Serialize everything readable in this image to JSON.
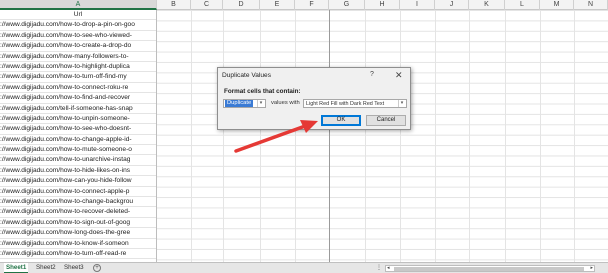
{
  "columns": [
    "A",
    "B",
    "C",
    "D",
    "E",
    "F",
    "G",
    "H",
    "I",
    "J",
    "K",
    "L",
    "M",
    "N"
  ],
  "header_cell": "Url",
  "urls": [
    "://www.digijadu.com/how-to-drop-a-pin-on-goo",
    "://www.digijadu.com/how-to-see-who-viewed-",
    "://www.digijadu.com/how-to-create-a-drop-do",
    "://www.digijadu.com/how-many-followers-to-",
    "://www.digijadu.com/how-to-highlight-duplica",
    "://www.digijadu.com/how-to-turn-off-find-my",
    "://www.digijadu.com/how-to-connect-roku-re",
    "://www.digijadu.com/how-to-find-and-recover",
    "://www.digijadu.com/tell-if-someone-has-snap",
    "://www.digijadu.com/how-to-unpin-someone-",
    "://www.digijadu.com/how-to-see-who-doesnt-",
    "://www.digijadu.com/how-to-change-apple-id-",
    "://www.digijadu.com/how-to-mute-someone-o",
    "://www.digijadu.com/how-to-unarchive-instag",
    "://www.digijadu.com/how-to-hide-likes-on-ins",
    "://www.digijadu.com/how-can-you-hide-follow",
    "://www.digijadu.com/how-to-connect-apple-p",
    "://www.digijadu.com/how-to-change-backgrou",
    "://www.digijadu.com/how-to-recover-deleted-",
    "://www.digijadu.com/how-to-sign-out-of-goog",
    "://www.digijadu.com/how-long-does-the-gree",
    "://www.digijadu.com/how-to-know-if-someon",
    "://www.digijadu.com/how-to-turn-off-read-re"
  ],
  "dialog": {
    "title": "Duplicate Values",
    "help": "?",
    "close": "✕",
    "label": "Format cells that contain:",
    "type_value": "Duplicate",
    "values_with": "values with",
    "format_value": "Light Red Fill with Dark Red Text",
    "ok": "OK",
    "cancel": "Cancel",
    "caret": "▾"
  },
  "tabs": {
    "sheets": [
      "Sheet1",
      "Sheet2",
      "Sheet3"
    ],
    "add": "+",
    "ellipsis": "⋮"
  },
  "colors": {
    "accent_green": "#217346",
    "arrow_red": "#e53935",
    "select_blue": "#3a7bd5",
    "ok_border": "#0078d7"
  }
}
